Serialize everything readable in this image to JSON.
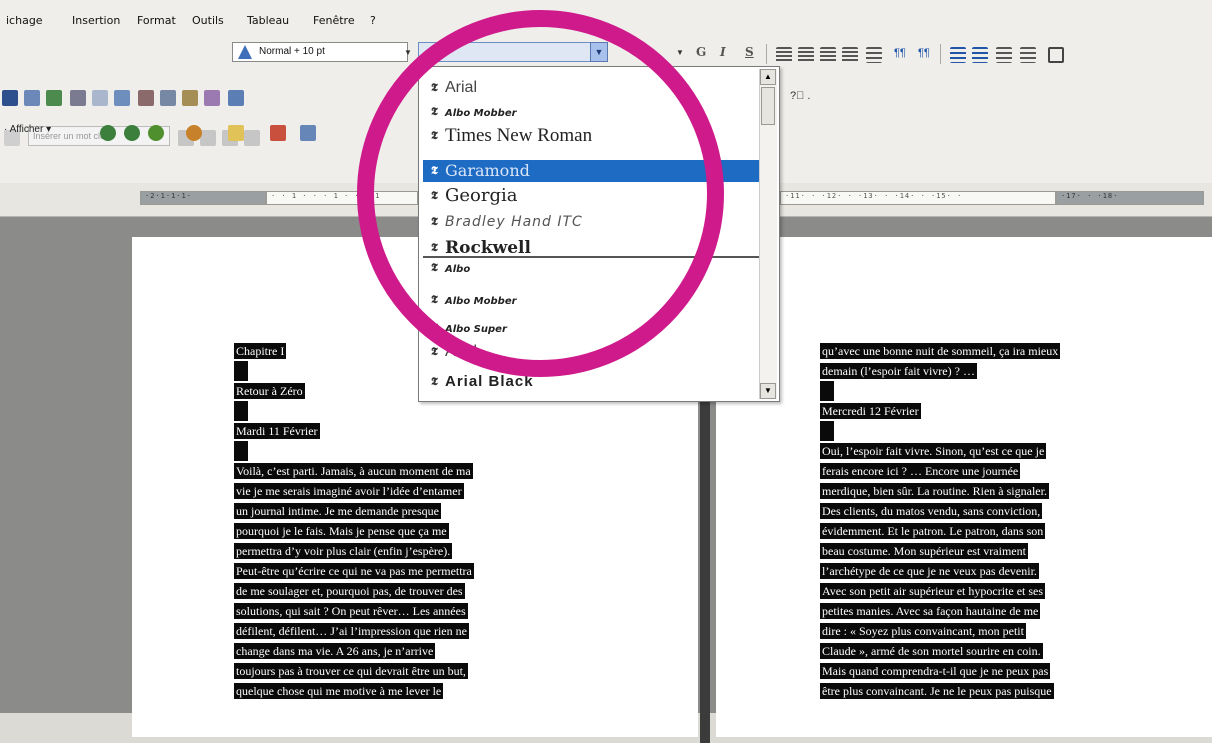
{
  "menu": {
    "items": [
      "ichage",
      "Insertion",
      "Format",
      "Outils",
      "Tableau",
      "Fenêtre",
      "?"
    ]
  },
  "toolbar": {
    "style_value": "Normal + 10 pt",
    "font_value": "",
    "format_buttons": [
      "G",
      "I",
      "S"
    ],
    "insert_field_label": "Insérer un mot clé",
    "afficher_label": "Afficher",
    "help_icon": "help-question-icon"
  },
  "font_list": {
    "recent": [
      {
        "name": "Arial",
        "selected": false
      },
      {
        "name": "Albo Mobber",
        "selected": false
      },
      {
        "name": "Times New Roman",
        "selected": false
      },
      {
        "name": "Garamond",
        "selected": true
      },
      {
        "name": "Georgia",
        "selected": false
      },
      {
        "name": "Bradley Hand ITC",
        "selected": false
      },
      {
        "name": "Rockwell",
        "selected": false
      }
    ],
    "all": [
      {
        "name": "Albo",
        "selected": false
      },
      {
        "name": "Albo Mobber",
        "selected": false
      },
      {
        "name": "Albo Super",
        "selected": false
      },
      {
        "name": "Arial",
        "selected": false
      },
      {
        "name": "Arial Black",
        "selected": false
      }
    ],
    "selected_color": "#1e6bc4",
    "truetype_icon": "truetype-font-icon"
  },
  "ruler": {
    "left_text": "·2·1·1·1·",
    "left_page_text": "· · 1 · · · 1 · · · 1",
    "right_text": "·11· · ·12· · ·13· · ·14· · ·15· ·",
    "right_end_text": "·17· · ·18·"
  },
  "highlight": {
    "circle_color": "#cf1a8b"
  },
  "document": {
    "left_page": [
      "Chapitre I",
      "",
      "Retour à Zéro",
      "",
      "Mardi 11 Février",
      "",
      "Voilà, c’est parti. Jamais, à aucun moment de ma",
      "vie je me serais imaginé avoir l’idée d’entamer",
      "un journal intime. Je me demande presque",
      "pourquoi je le fais. Mais je pense que ça me",
      "permettra d’y voir plus clair (enfin j’espère).",
      "Peut-être qu’écrire ce qui ne va pas me permettra",
      "de me soulager et, pourquoi pas, de trouver des",
      "solutions, qui sait ? On peut rêver… Les années",
      "défilent, défilent… J’ai l’impression que rien ne",
      "change dans ma vie. A 26 ans, je n’arrive",
      "toujours pas à trouver ce qui devrait être un but,",
      "quelque chose qui me motive à me lever le"
    ],
    "right_page": [
      "qu’avec une bonne nuit de sommeil, ça ira mieux",
      "demain (l’espoir fait vivre) ? …",
      "",
      "Mercredi 12 Février",
      "",
      "Oui, l’espoir fait vivre. Sinon, qu’est ce que je",
      "ferais encore ici ? … Encore une journée",
      "merdique, bien sûr. La routine. Rien à signaler.",
      "Des clients, du matos vendu, sans conviction,",
      "évidemment. Et le patron. Le patron, dans son",
      "beau costume. Mon supérieur est vraiment",
      "l’archétype de ce que je ne veux pas devenir.",
      "Avec son petit air supérieur et hypocrite et ses",
      "petites manies. Avec sa façon hautaine de me",
      "dire : « Soyez plus convaincant, mon petit",
      "Claude », armé de son mortel sourire en coin.",
      "Mais quand comprendra-t-il que je ne peux pas",
      "être plus convaincant. Je ne le peux pas puisque"
    ]
  }
}
